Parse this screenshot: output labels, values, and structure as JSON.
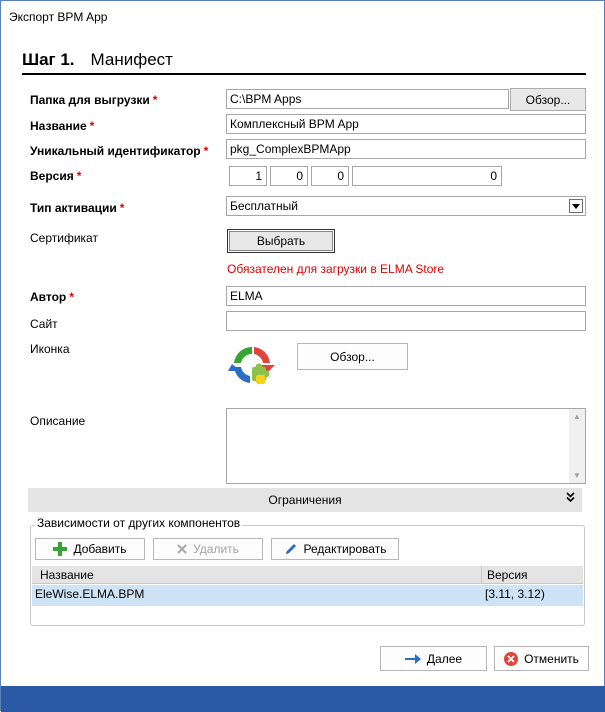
{
  "window": {
    "title": "Экспорт BPM App"
  },
  "step": {
    "number": "Шаг 1.",
    "name": "Манифест"
  },
  "required_mark": "*",
  "export_folder": {
    "label": "Папка для выгрузки",
    "value": "C:\\BPM Apps",
    "browse_label": "Обзор..."
  },
  "name": {
    "label": "Название",
    "value": "Комплексный BPM App"
  },
  "unique_id": {
    "label": "Уникальный идентификатор",
    "value": "pkg_ComplexBPMApp"
  },
  "version": {
    "label": "Версия",
    "major": "1",
    "minor": "0",
    "build": "0",
    "revision": "0"
  },
  "activation": {
    "label": "Тип активации",
    "value": "Бесплатный",
    "arrow_icon": "chevron-down-icon"
  },
  "certificate": {
    "label": "Сертификат",
    "button_label": "Выбрать",
    "hint": "Обязателен для загрузки в ELMA Store"
  },
  "author": {
    "label": "Автор",
    "value": "ELMA"
  },
  "site": {
    "label": "Сайт",
    "value": ""
  },
  "icon": {
    "label": "Иконка",
    "browse_label": "Обзор...",
    "image": "elma-bpm-app-logo"
  },
  "description": {
    "label": "Описание",
    "value": ""
  },
  "limits": {
    "label": "Ограничения",
    "icon": "double-chevron-down-icon"
  },
  "dependencies": {
    "title": "Зависимости от других компонентов",
    "add_label": "Добавить",
    "delete_label": "Удалить",
    "edit_label": "Редактировать",
    "columns": [
      "Название",
      "Версия"
    ],
    "rows": [
      {
        "name": "EleWise.ELMA.BPM",
        "version": "[3.11, 3.12)"
      }
    ]
  },
  "footer": {
    "next_label": "Далее",
    "cancel_label": "Отменить"
  },
  "colors": {
    "required": "#e00000",
    "accent": "#2b59a6",
    "selected_row": "#cfe3f7",
    "add_green": "#3aa335",
    "cancel_red": "#e0453a"
  }
}
